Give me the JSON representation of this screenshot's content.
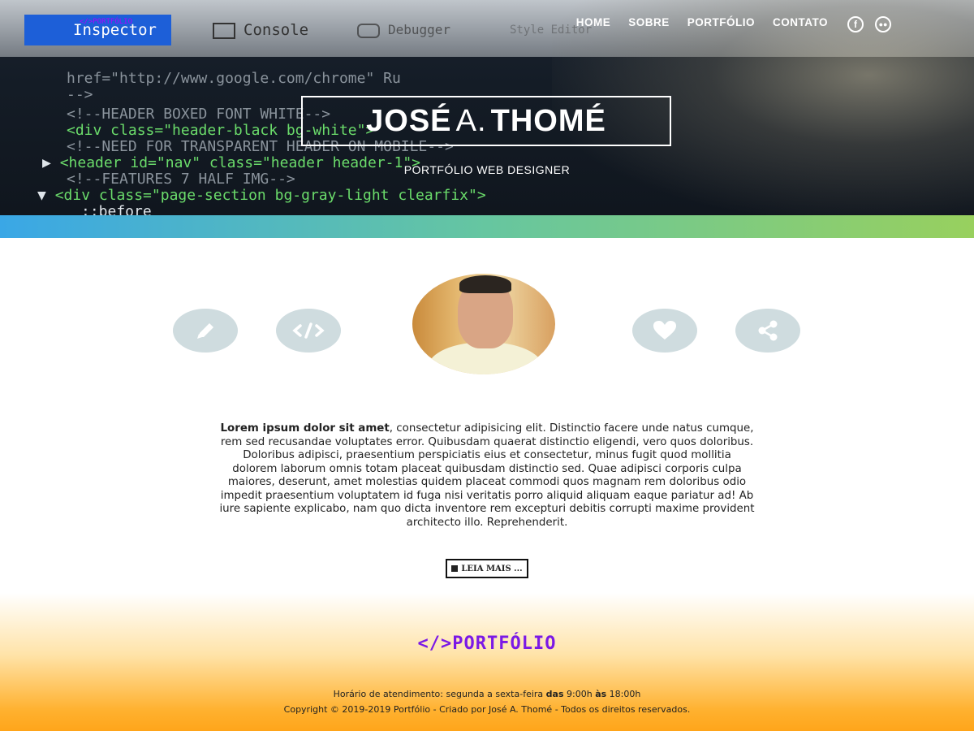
{
  "devtools": {
    "tabs": [
      "Inspector",
      "Console",
      "Debugger",
      "Style Editor"
    ],
    "badge": "</>PORTFÓLIO",
    "code_lines": [
      "href=\"http://www.google.com/chrome\" Ru",
      "-->",
      "<!--HEADER BOXED FONT WHITE-->",
      "<div class=\"header-black bg-white\">",
      "<!--NEED FOR TRANSPARENT HEADER ON MOBILE-->",
      "<header id=\"nav\" class=\"header header-1\">",
      "<!--FEATURES 7 HALF IMG-->",
      "<div class=\"page-section bg-gray-light clearfix\">",
      "::before"
    ]
  },
  "nav": {
    "items": [
      "HOME",
      "SOBRE",
      "PORTFÓLIO",
      "CONTATO"
    ],
    "social": [
      "facebook-icon",
      "discord-icon"
    ]
  },
  "hero": {
    "name_first": "JOSÉ",
    "name_middle": "A.",
    "name_last": "THOMÉ",
    "subtitle": "PORTFÓLIO WEB DESIGNER"
  },
  "icons": [
    "pencil-icon",
    "code-icon",
    "heart-icon",
    "share-icon"
  ],
  "about": {
    "lead": "Lorem ipsum dolor sit amet",
    "text": ", consectetur adipisicing elit. Distinctio facere unde natus cumque, rem sed recusandae voluptates error. Quibusdam quaerat distinctio eligendi, vero quos doloribus. Doloribus adipisci, praesentium perspiciatis eius et consectetur, minus fugit quod mollitia dolorem laborum omnis totam placeat quibusdam distinctio sed. Quae adipisci corporis culpa maiores, deserunt, amet molestias quidem placeat commodi quos magnam rem doloribus odio impedit praesentium voluptatem id fuga nisi veritatis porro aliquid aliquam eaque pariatur ad! Ab iure sapiente explicabo, nam quo dicta inventore rem excepturi debitis corrupti maxime provident architecto illo. Reprehenderit.",
    "button": "LEIA MAIS ..."
  },
  "footer": {
    "logo": "</>PORTFÓLIO",
    "hours_prefix": "Horário de atendimento: segunda a sexta-feira ",
    "hours_das": "das",
    "hours_start": " 9:00h ",
    "hours_as": "às",
    "hours_end": " 18:00h",
    "copyright": "Copyright © 2019-2019 Portfólio - Criado por José A. Thomé - Todos os direitos reservados."
  }
}
